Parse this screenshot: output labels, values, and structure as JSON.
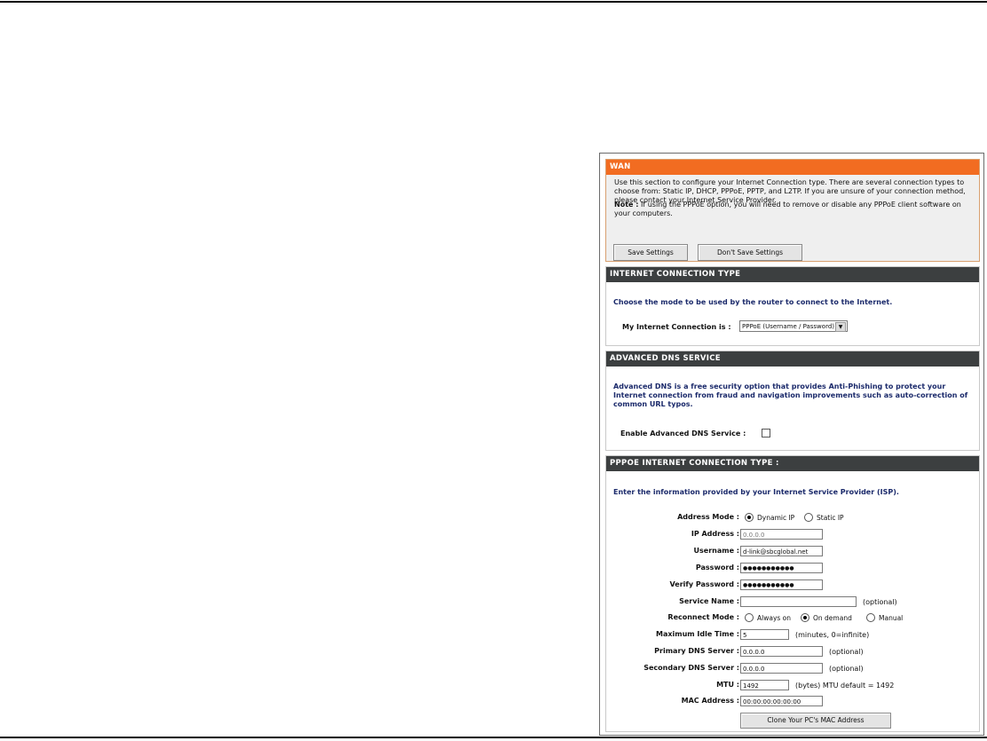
{
  "wan": {
    "title": "WAN",
    "description": "Use this section to configure your Internet Connection type. There are several connection types to choose from: Static IP, DHCP, PPPoE, PPTP, and L2TP. If you are unsure of your connection method, please contact your Internet Service Provider.",
    "note_label": "Note :",
    "note_text": "If using the PPPoE option, you will need to remove or disable any PPPoE client software on your computers.",
    "save_button": "Save Settings",
    "dont_save_button": "Don't Save Settings"
  },
  "connection_type": {
    "title": "INTERNET CONNECTION TYPE",
    "description": "Choose the mode to be used by the router to connect to the Internet.",
    "label": "My Internet Connection is :",
    "selected": "PPPoE (Username / Password)"
  },
  "dns": {
    "title": "ADVANCED DNS SERVICE",
    "description": "Advanced DNS is a free security option that provides Anti-Phishing to protect your Internet connection from fraud and navigation improvements such as auto-correction of common URL typos.",
    "label": "Enable Advanced DNS Service :",
    "checked": false
  },
  "pppoe": {
    "title": "PPPOE INTERNET CONNECTION TYPE :",
    "description": "Enter the information provided by your Internet Service Provider (ISP).",
    "address_mode_label": "Address Mode :",
    "address_mode_options": [
      "Dynamic IP",
      "Static IP"
    ],
    "address_mode_selected": "Dynamic IP",
    "ip_address_label": "IP Address :",
    "ip_address_value": "0.0.0.0",
    "username_label": "Username :",
    "username_value": "d-link@sbcglobal.net",
    "password_label": "Password :",
    "password_value": "●●●●●●●●●●●",
    "verify_password_label": "Verify Password :",
    "verify_password_value": "●●●●●●●●●●●",
    "service_name_label": "Service Name :",
    "service_name_value": "",
    "service_name_hint": "(optional)",
    "reconnect_label": "Reconnect Mode :",
    "reconnect_options": [
      "Always on",
      "On demand",
      "Manual"
    ],
    "reconnect_selected": "On demand",
    "idle_label": "Maximum Idle Time :",
    "idle_value": "5",
    "idle_hint": "(minutes, 0=infinite)",
    "primary_dns_label": "Primary DNS Server :",
    "primary_dns_value": "0.0.0.0",
    "primary_dns_hint": "(optional)",
    "secondary_dns_label": "Secondary DNS Server :",
    "secondary_dns_value": "0.0.0.0",
    "secondary_dns_hint": "(optional)",
    "mtu_label": "MTU :",
    "mtu_value": "1492",
    "mtu_hint": "(bytes) MTU default = 1492",
    "mac_label": "MAC Address :",
    "mac_value": "00:00:00:00:00:00",
    "clone_button": "Clone Your PC's MAC Address"
  }
}
